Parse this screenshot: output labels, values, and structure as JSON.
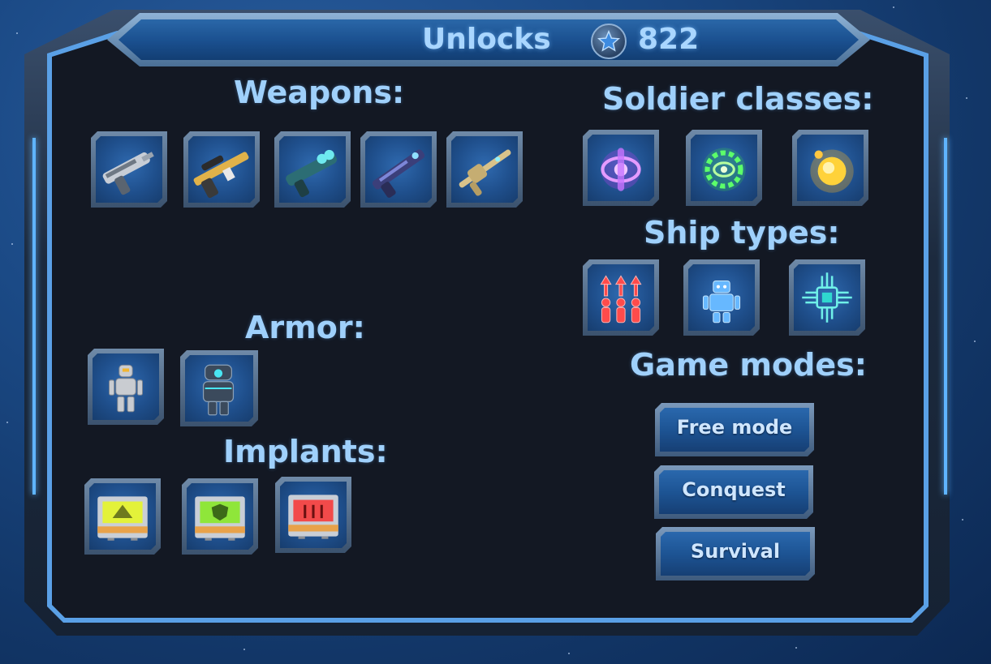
{
  "header": {
    "title": "Unlocks",
    "currency_icon": "star-icon",
    "currency_value": "822"
  },
  "sections": {
    "weapons": {
      "title": "Weapons:",
      "items": [
        "pistol-icon",
        "sniper-rifle-icon",
        "plasma-rifle-icon",
        "laser-rifle-icon",
        "railgun-icon"
      ]
    },
    "soldier_classes": {
      "title": "Soldier classes:",
      "items": [
        "purple-class-emblem-icon",
        "green-gear-emblem-icon",
        "yellow-orb-emblem-icon"
      ]
    },
    "ship_types": {
      "title": "Ship types:",
      "items": [
        "crew-upgrade-icon",
        "robot-icon",
        "circuit-chip-icon"
      ]
    },
    "armor": {
      "title": "Armor:",
      "items": [
        "light-armor-icon",
        "heavy-armor-icon"
      ]
    },
    "implants": {
      "title": "Implants:",
      "items": [
        "speed-implant-icon",
        "shield-implant-icon",
        "damage-implant-icon"
      ]
    },
    "game_modes": {
      "title": "Game modes:",
      "buttons": [
        "Free mode",
        "Conquest",
        "Survival"
      ]
    }
  },
  "colors": {
    "accent": "#9fd0fb",
    "panel": "#131823",
    "frame_glow": "#5fb4ff",
    "slot_blue": "#1f4f8c"
  }
}
